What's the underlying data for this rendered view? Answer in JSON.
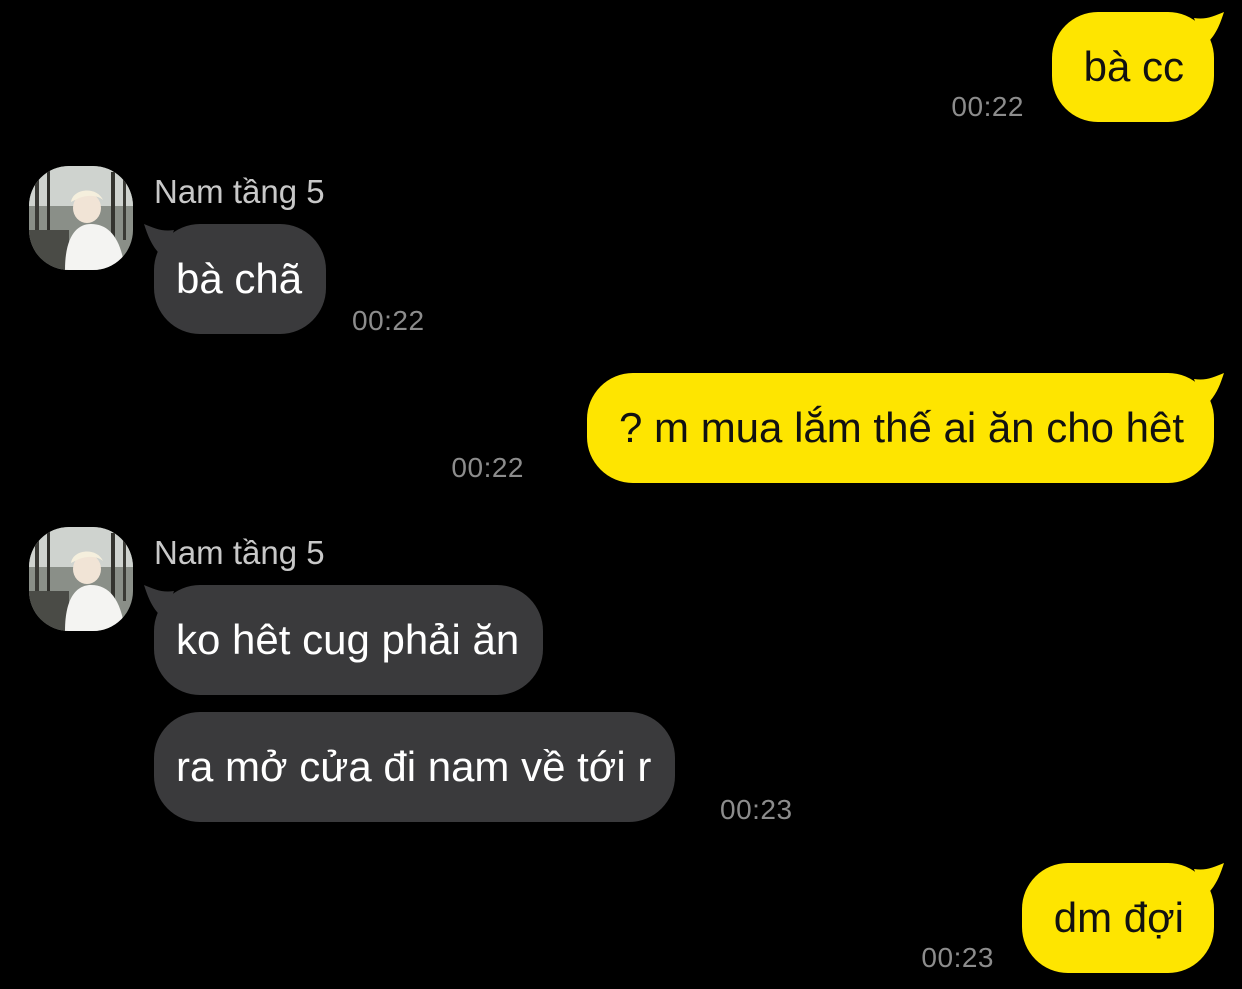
{
  "colors": {
    "background": "#000000",
    "outgoing_bubble": "#FEE500",
    "incoming_bubble": "#3A3A3C",
    "timestamp": "#8C8C8C",
    "sender_name": "#C8C8C8"
  },
  "messages": [
    {
      "direction": "outgoing",
      "text": "bà cc",
      "time": "00:22"
    },
    {
      "direction": "incoming",
      "sender": "Nam tầng 5",
      "avatar_icon": "contact-avatar-photo",
      "text": "bà chã",
      "time": "00:22"
    },
    {
      "direction": "outgoing",
      "text": "? m mua lắm thế ai ăn cho hêt",
      "time": "00:22"
    },
    {
      "direction": "incoming",
      "sender": "Nam tầng 5",
      "avatar_icon": "contact-avatar-photo",
      "text": "ko hêt cug phải ăn"
    },
    {
      "direction": "incoming",
      "text": "ra mở cửa đi nam về tới r",
      "time": "00:23"
    },
    {
      "direction": "outgoing",
      "text": "dm đợi",
      "time": "00:23"
    }
  ]
}
